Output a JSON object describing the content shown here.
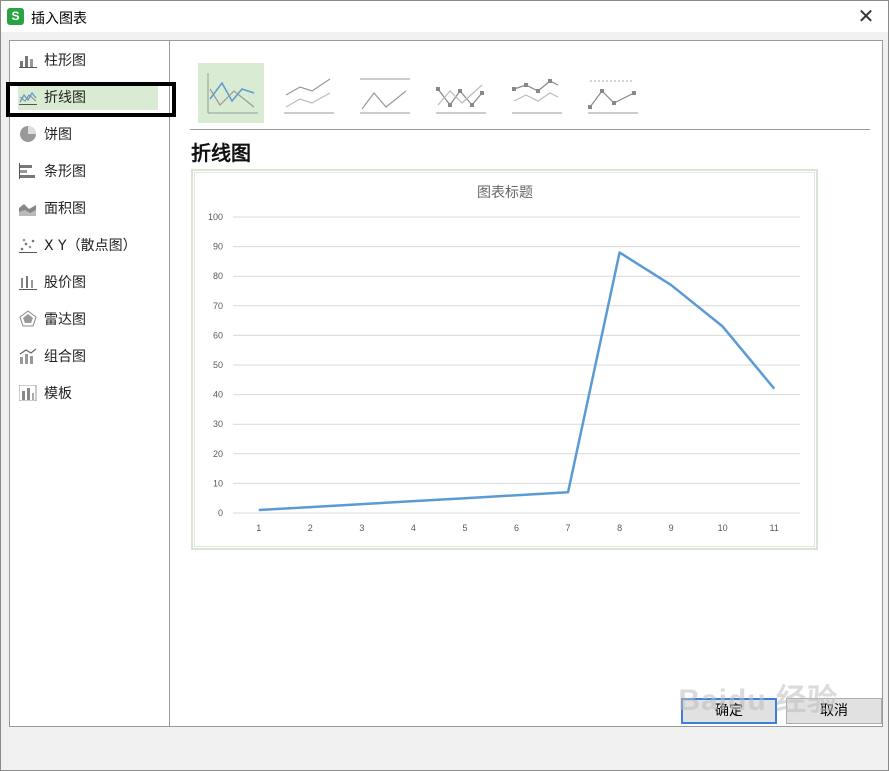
{
  "window": {
    "title": "插入图表",
    "app_icon": "S"
  },
  "sidebar": {
    "items": [
      {
        "label": "柱形图",
        "icon": "column-chart-icon"
      },
      {
        "label": "折线图",
        "icon": "line-chart-icon"
      },
      {
        "label": "饼图",
        "icon": "pie-chart-icon"
      },
      {
        "label": "条形图",
        "icon": "bar-chart-icon"
      },
      {
        "label": "面积图",
        "icon": "area-chart-icon"
      },
      {
        "label": "X Y（散点图）",
        "icon": "scatter-chart-icon"
      },
      {
        "label": "股价图",
        "icon": "stock-chart-icon"
      },
      {
        "label": "雷达图",
        "icon": "radar-chart-icon"
      },
      {
        "label": "组合图",
        "icon": "combo-chart-icon"
      },
      {
        "label": "模板",
        "icon": "template-icon"
      }
    ],
    "selected_index": 1
  },
  "subtypes": [
    "line",
    "stacked-line",
    "percent-stacked-line",
    "line-markers",
    "stacked-line-markers",
    "percent-stacked-line-markers"
  ],
  "main": {
    "heading": "折线图"
  },
  "chart_data": {
    "type": "line",
    "title": "图表标题",
    "x": [
      1,
      2,
      3,
      4,
      5,
      6,
      7,
      8,
      9,
      10,
      11
    ],
    "series": [
      {
        "values": [
          1,
          2,
          3,
          4,
          5,
          6,
          7,
          88,
          77,
          63,
          42
        ],
        "color": "#5b9bd5"
      }
    ],
    "yticks": [
      "0",
      "10",
      "20",
      "30",
      "40",
      "50",
      "60",
      "70",
      "80",
      "90",
      "100"
    ],
    "ylim": [
      0,
      100
    ],
    "grid": true
  },
  "buttons": {
    "ok": "确定",
    "cancel": "取消"
  },
  "watermark": "Baidu 经验",
  "colors": {
    "selected_bg": "#d9ebd2",
    "line": "#5b9bd5",
    "highlight_border": "#000000"
  }
}
